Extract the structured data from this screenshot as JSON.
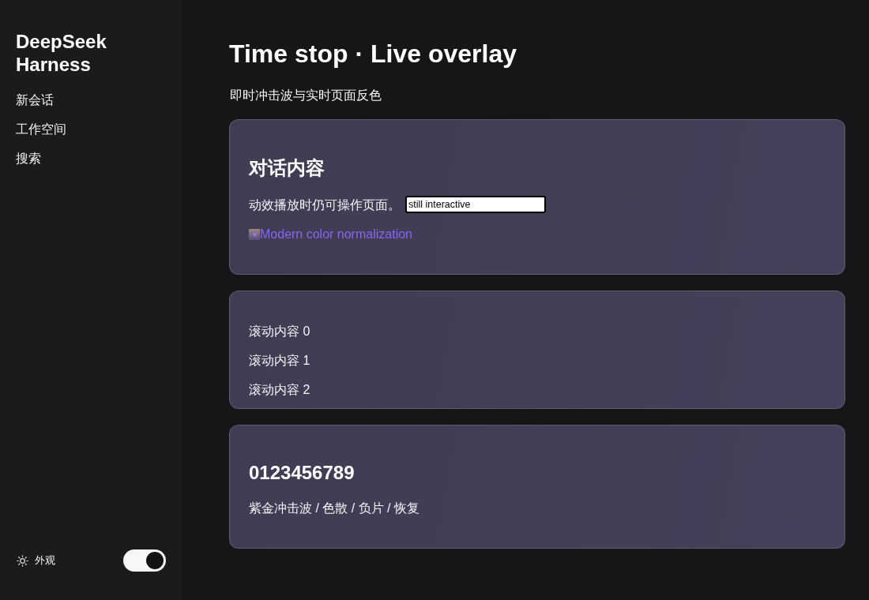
{
  "sidebar": {
    "title": "DeepSeek Harness",
    "nav_items": [
      {
        "label": "新会话"
      },
      {
        "label": "工作空间"
      },
      {
        "label": "搜索"
      }
    ],
    "appearance": {
      "label": "外观",
      "on": true
    }
  },
  "header": {
    "title": "Time stop · Live overlay",
    "subtitle": "即时冲击波与实时页面反色"
  },
  "cards": [
    {
      "kind": "form",
      "heading": "对话内容",
      "text": "动效播放时仍可操作页面。",
      "input": {
        "value": "still interactive"
      },
      "link": {
        "label": "Modern color normalization"
      }
    },
    {
      "kind": "scroll",
      "items": [
        "滚动内容 0",
        "滚动内容 1",
        "滚动内容 2"
      ]
    },
    {
      "kind": "text",
      "heading": "0123456789",
      "text": "紫金冲击波 / 色散 / 负片 / 恢复"
    }
  ]
}
